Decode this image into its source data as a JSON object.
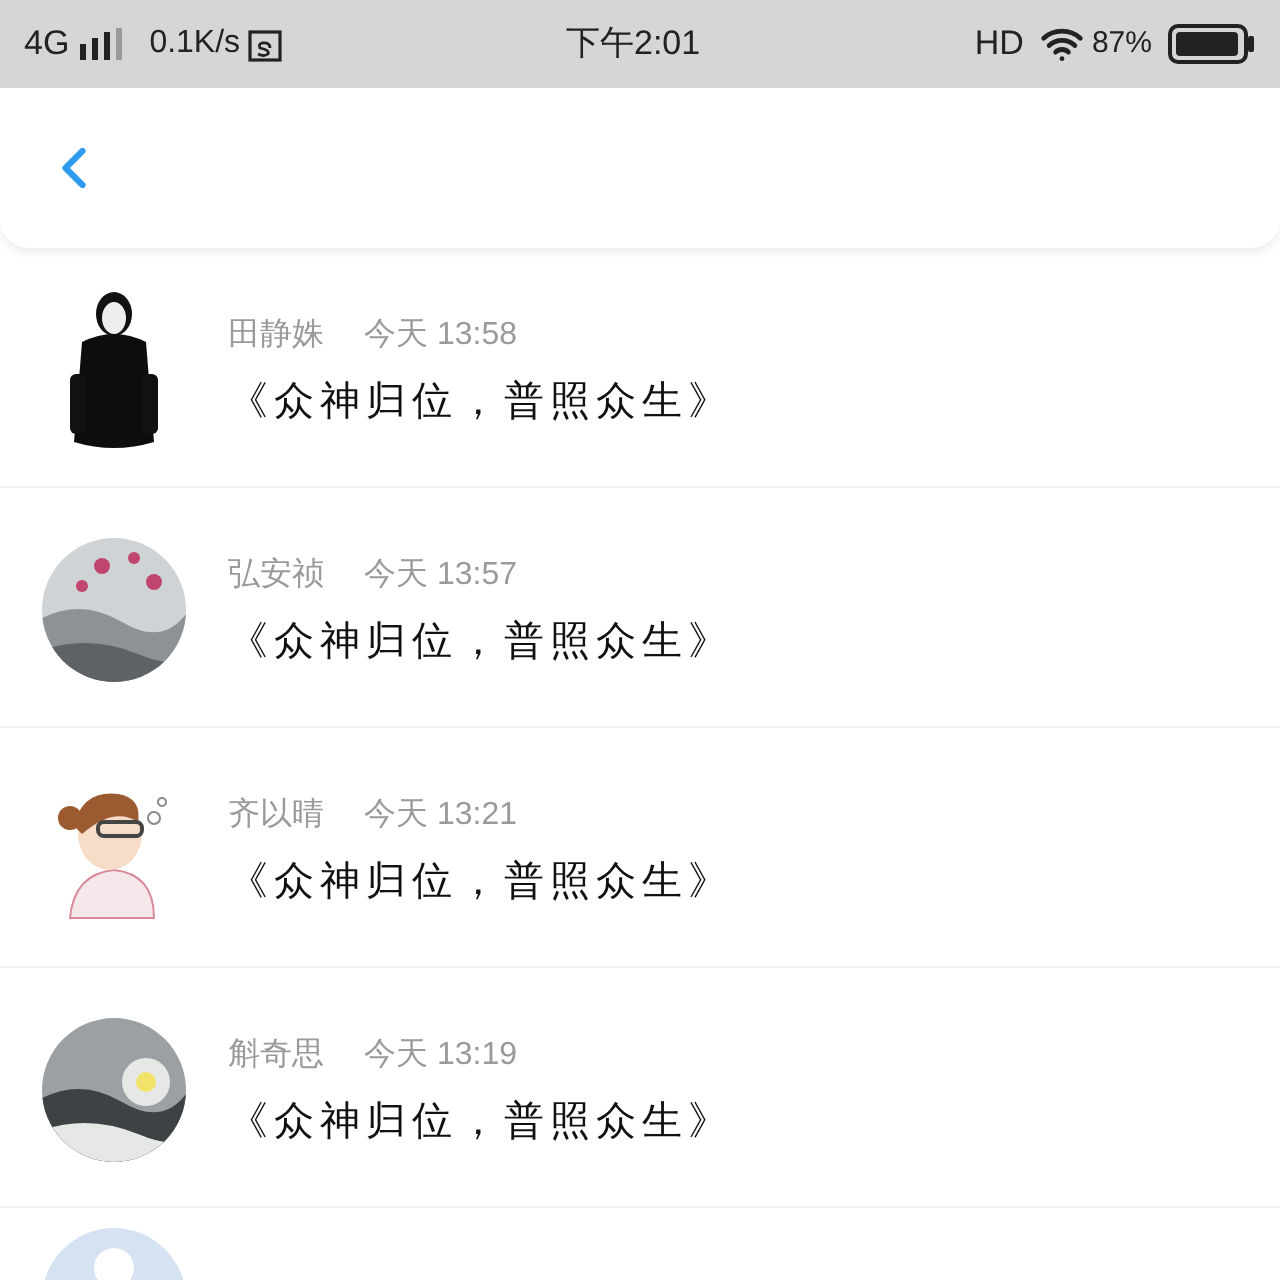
{
  "status_bar": {
    "network": "4G",
    "speed": "0.1K/s",
    "time": "下午2:01",
    "hd": "HD",
    "battery": "87%"
  },
  "messages": [
    {
      "name": "田静姝",
      "time": "今天 13:58",
      "text": "《众神归位，普照众生》"
    },
    {
      "name": "弘安祯",
      "time": "今天 13:57",
      "text": "《众神归位，普照众生》"
    },
    {
      "name": "齐以晴",
      "time": "今天 13:21",
      "text": "《众神归位，普照众生》"
    },
    {
      "name": "斛奇思",
      "time": "今天 13:19",
      "text": "《众神归位，普照众生》"
    }
  ]
}
